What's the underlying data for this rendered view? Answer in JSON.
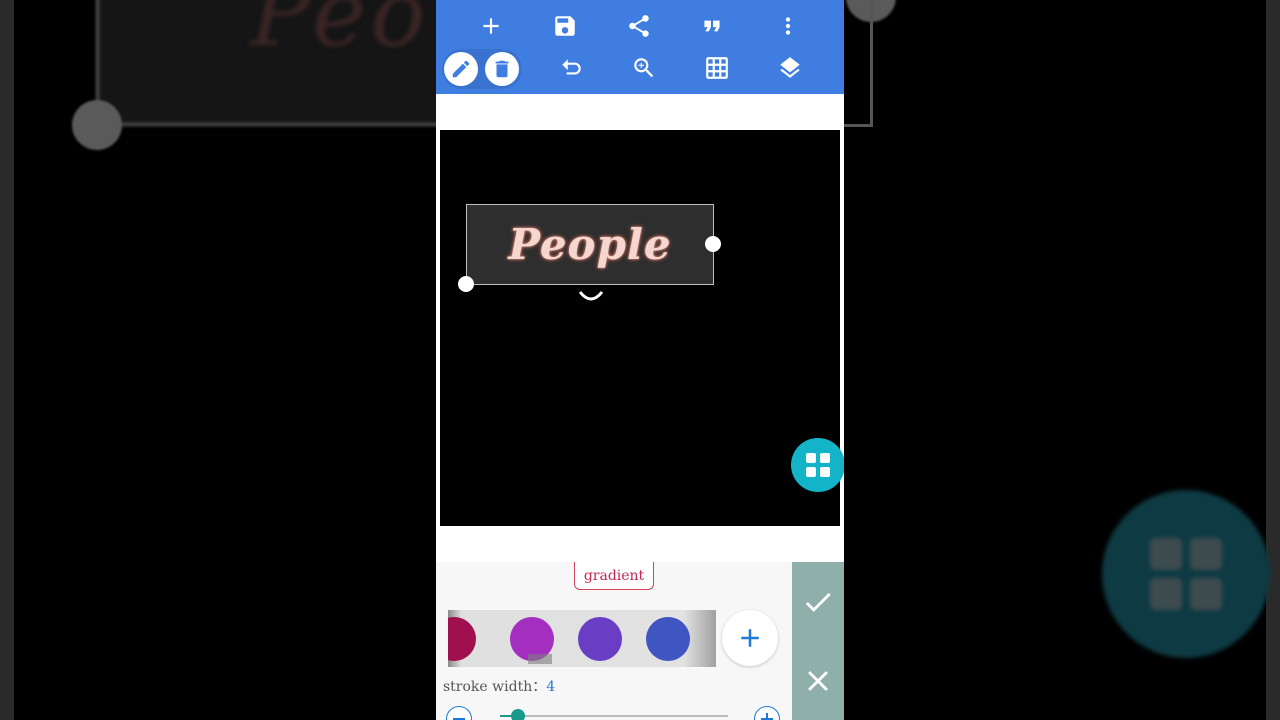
{
  "background": {
    "word": "Peo",
    "colors": {
      "fab": "#0e3a43",
      "box": "#151515"
    }
  },
  "toolbar": {
    "color": "#3f7ee0",
    "row1_icons": [
      "add-icon",
      "save-icon",
      "share-icon",
      "quote-icon",
      "more-vert-icon"
    ],
    "row2_icons": [
      "pencil-icon",
      "trash-icon",
      "undo-icon",
      "zoom-in-icon",
      "grid-icon",
      "layers-icon"
    ]
  },
  "canvas": {
    "text": "People",
    "text_color": "#f6d7cf",
    "background": "#000000",
    "textbox_background": "#2e2e2e",
    "fab_color": "#14b4c8",
    "fab_icon": "apps-grid-icon"
  },
  "panel": {
    "gradient_label": "gradient",
    "swatches": [
      "#a0104f",
      "#a42ec0",
      "#6a3ec4",
      "#3f55c2"
    ],
    "add_color_icon": "plus-icon",
    "stroke_label": "stroke width：",
    "stroke_value": "4",
    "slider_fraction": 0.08,
    "accent": "#1d78d6",
    "slider_color": "#18998a"
  },
  "actions": {
    "confirm_icon": "check-icon",
    "cancel_icon": "close-icon"
  }
}
